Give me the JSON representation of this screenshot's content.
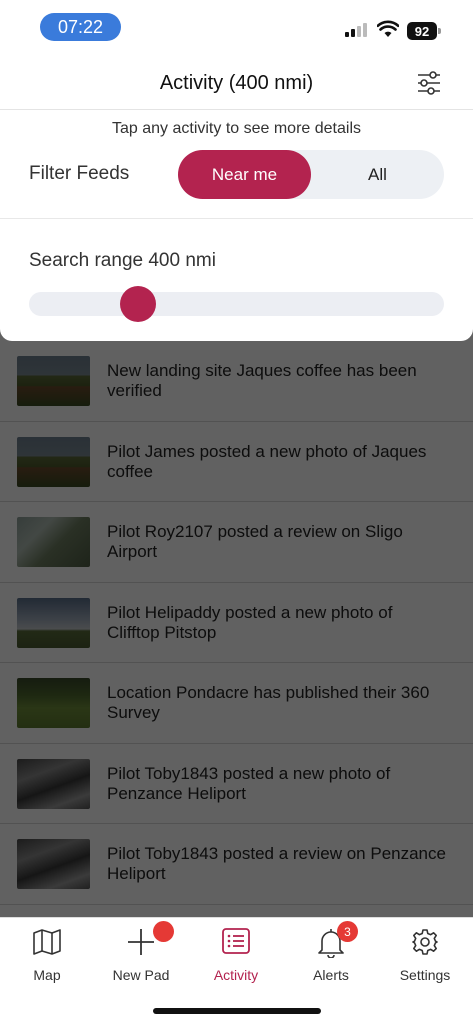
{
  "status_bar": {
    "time": "07:22",
    "battery": "92"
  },
  "header": {
    "title": "Activity (400 nmi)"
  },
  "panel": {
    "hint": "Tap any activity to see more details",
    "filter_label": "Filter Feeds",
    "segments": [
      "Near me",
      "All"
    ],
    "selected_segment": "Near me",
    "range_label": "Search range 400 nmi",
    "range_fraction": 0.24
  },
  "activities": [
    {
      "text": "New landing site Jaques coffee has been verified",
      "thumb": "field"
    },
    {
      "text": "Pilot James posted a new photo of Jaques coffee",
      "thumb": "field"
    },
    {
      "text": "Pilot Roy2107 posted a review on Sligo Airport",
      "thumb": "aerial"
    },
    {
      "text": "Pilot Helipaddy posted a new photo of Clifftop Pitstop",
      "thumb": "sky"
    },
    {
      "text": "Location Pondacre has published their 360 Survey",
      "thumb": "grass"
    },
    {
      "text": "Pilot Toby1843 posted a new photo of Penzance Heliport",
      "thumb": "heli"
    },
    {
      "text": "Pilot Toby1843 posted a review on Penzance Heliport",
      "thumb": "heli"
    }
  ],
  "tabs": [
    {
      "label": "Map",
      "icon": "map-icon"
    },
    {
      "label": "New Pad",
      "icon": "plus-icon"
    },
    {
      "label": "Activity",
      "icon": "list-icon",
      "active": true
    },
    {
      "label": "Alerts",
      "icon": "bell-icon",
      "badge": "3"
    },
    {
      "label": "Settings",
      "icon": "gear-icon"
    }
  ],
  "colors": {
    "accent": "#b3234f",
    "badge": "#e53935",
    "time_pill": "#3a7bdb"
  }
}
